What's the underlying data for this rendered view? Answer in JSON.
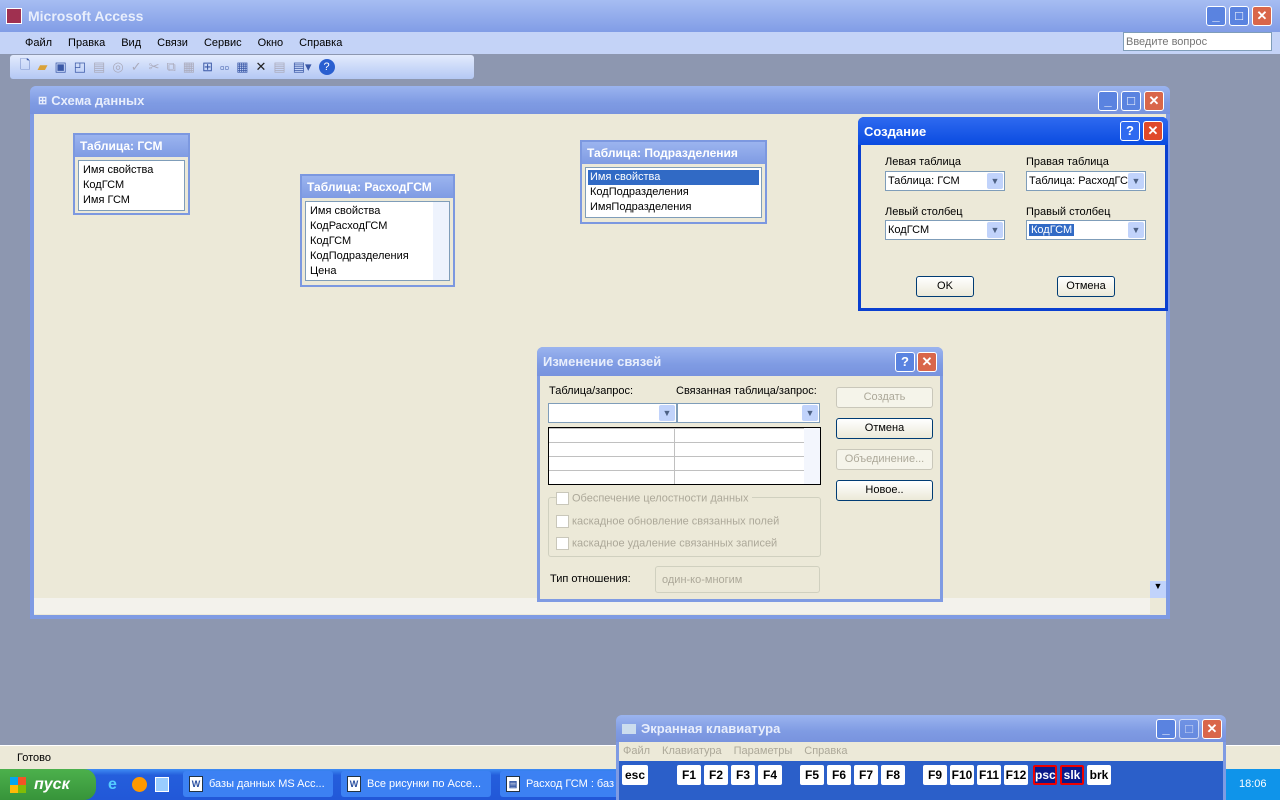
{
  "app": {
    "title": "Microsoft Access"
  },
  "menu": [
    "Файл",
    "Правка",
    "Вид",
    "Связи",
    "Сервис",
    "Окно",
    "Справка"
  ],
  "help_box": {
    "placeholder": "Введите вопрос"
  },
  "schema": {
    "title": "Схема данных",
    "tables": [
      {
        "title": "Таблица: ГСМ",
        "fields": [
          "Имя свойства",
          "КодГСМ",
          "Имя ГСМ"
        ]
      },
      {
        "title": "Таблица: РасходГСМ",
        "fields": [
          "Имя свойства",
          "КодРасходГСМ",
          "КодГСМ",
          "КодПодразделения",
          "Цена"
        ]
      },
      {
        "title": "Таблица: Подразделения",
        "fields": [
          "Имя свойства",
          "КодПодразделения",
          "ИмяПодразделения"
        ]
      }
    ]
  },
  "create_dialog": {
    "title": "Создание",
    "left_table_label": "Левая таблица",
    "left_table": "Таблица: ГСМ",
    "right_table_label": "Правая таблица",
    "right_table": "Таблица: РасходГС",
    "left_col_label": "Левый столбец",
    "left_col": "КодГСМ",
    "right_col_label": "Правый столбец",
    "right_col": "КодГСМ",
    "ok": "OK",
    "cancel": "Отмена"
  },
  "edit_dialog": {
    "title": "Изменение связей",
    "table_label": "Таблица/запрос:",
    "related_label": "Связанная таблица/запрос:",
    "create": "Создать",
    "cancel": "Отмена",
    "join": "Объединение...",
    "new": "Новое..",
    "integrity": "Обеспечение целостности данных",
    "cascade_update": "каскадное обновление связанных полей",
    "cascade_delete": "каскадное удаление связанных записей",
    "rel_type_label": "Тип отношения:",
    "rel_type": "один-ко-многим"
  },
  "status": "Готово",
  "taskbar": {
    "start": "пуск",
    "tasks": [
      "базы данных MS Acc...",
      "Все рисунки по Acce...",
      "Расход ГСМ : баз"
    ],
    "clock": "18:06"
  },
  "osk": {
    "title": "Экранная клавиатура",
    "menu": [
      "Файл",
      "Клавиатура",
      "Параметры",
      "Справка"
    ],
    "keys": [
      "esc",
      "F1",
      "F2",
      "F3",
      "F4",
      "F5",
      "F6",
      "F7",
      "F8",
      "F9",
      "F10",
      "F11",
      "F12",
      "psc",
      "slk",
      "brk"
    ]
  }
}
